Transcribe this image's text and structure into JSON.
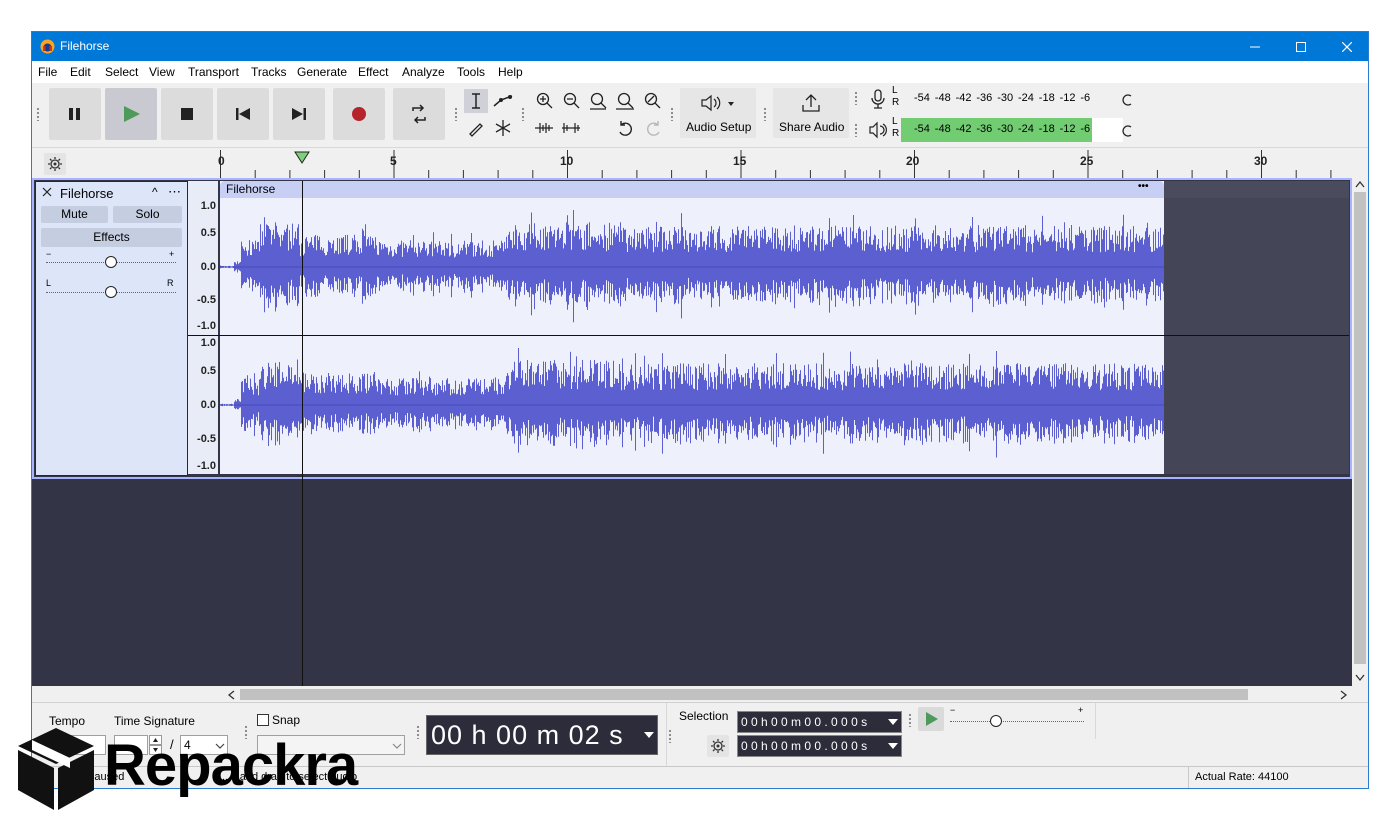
{
  "window": {
    "title": "Filehorse",
    "minimize_icon": "minimize-icon",
    "maximize_icon": "maximize-icon",
    "close_icon": "close-icon"
  },
  "menu": [
    "File",
    "Edit",
    "Select",
    "View",
    "Transport",
    "Tracks",
    "Generate",
    "Effect",
    "Analyze",
    "Tools",
    "Help"
  ],
  "toolbar": {
    "audio_setup_label": "Audio Setup",
    "share_audio_label": "Share Audio",
    "meter_scale": [
      "-54",
      "-48",
      "-42",
      "-36",
      "-30",
      "-24",
      "-18",
      "-12",
      "-6"
    ],
    "meter_channels": [
      "L",
      "R"
    ],
    "playback_level": 0.86
  },
  "timeline": {
    "ticks": [
      "0",
      "5",
      "10",
      "15",
      "20",
      "25",
      "30"
    ]
  },
  "track": {
    "name": "Filehorse",
    "mute_label": "Mute",
    "solo_label": "Solo",
    "effects_label": "Effects",
    "gain_minus": "−",
    "gain_plus": "+",
    "pan_left": "L",
    "pan_right": "R",
    "clip_name": "Filehorse",
    "clip_menu": "•••",
    "scale_labels": [
      "1.0",
      "0.5",
      "0.0",
      "-0.5",
      "-1.0"
    ],
    "collapse_icon": "^",
    "menu_dots": "⋯"
  },
  "bottom": {
    "tempo_label": "Tempo",
    "time_signature_label": "Time Signature",
    "time_sig_separator": "/",
    "time_sig_denominator": "4",
    "snap_label": "Snap",
    "time_display": "00 h 00 m 02 s",
    "selection_label": "Selection",
    "selection_start": "0 0 h 0 0 m 0 0 . 0 0 0 s",
    "selection_end": "0 0 h 0 0 m 0 0 . 0 0 0 s",
    "play_speed_minus": "−",
    "play_speed_plus": "+"
  },
  "status": {
    "left_text": "Paused",
    "middle_text": "...k and drag to select audio",
    "right_text": "Actual Rate: 44100"
  },
  "watermark": {
    "text": "Repackra"
  }
}
